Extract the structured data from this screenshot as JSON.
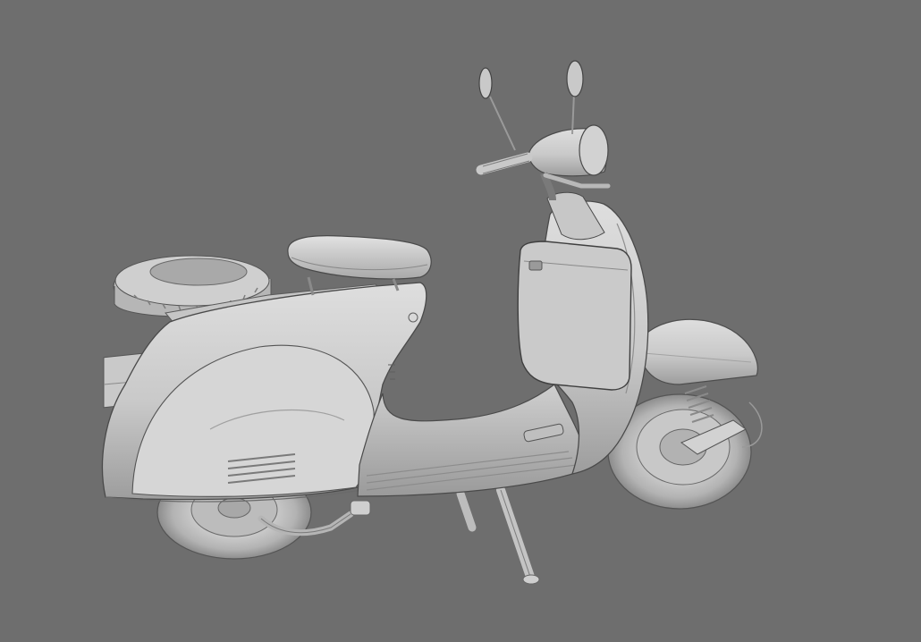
{
  "scene": {
    "subject": "scooter-3d-model",
    "render_style": "grey clay viewport render",
    "colors": {
      "background": "#6e6e6e",
      "body_light": "#d4d4d4",
      "body_mid": "#bdbdbd",
      "body_shadow": "#8f8f8f",
      "outline": "#3a3a3a"
    }
  }
}
